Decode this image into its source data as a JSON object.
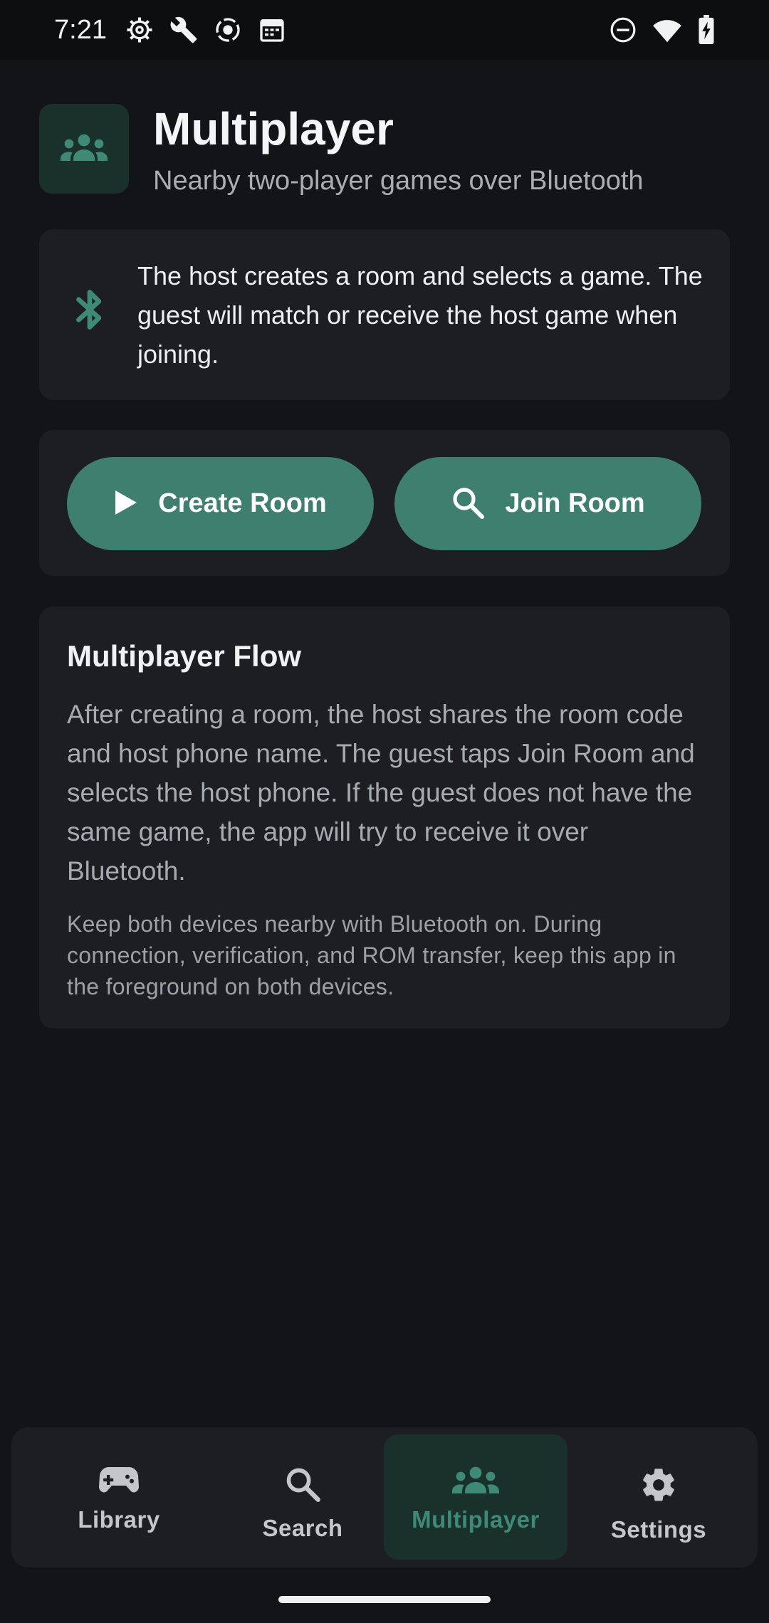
{
  "status_bar": {
    "time": "7:21",
    "left_icons": [
      "settings-gear-status-icon",
      "wrench-icon",
      "screen-record-icon",
      "calendar-icon"
    ],
    "right_icons": [
      "do-not-disturb-icon",
      "wifi-icon",
      "battery-charging-icon"
    ]
  },
  "header": {
    "icon": "group-icon",
    "title": "Multiplayer",
    "subtitle": "Nearby two-player games over Bluetooth"
  },
  "info_card": {
    "icon": "bluetooth-icon",
    "text": "The host creates a room and selects a game. The guest will match or receive the host game when joining."
  },
  "actions": {
    "create_room": {
      "icon": "play-icon",
      "label": "Create Room"
    },
    "join_room": {
      "icon": "search-icon",
      "label": "Join Room"
    }
  },
  "flow_card": {
    "title": "Multiplayer Flow",
    "body": "After creating a room, the host shares the room code and host phone name. The guest taps Join Room and selects the host phone. If the guest does not have the same game, the app will try to receive it over Bluetooth.",
    "note": "Keep both devices nearby with Bluetooth on. During connection, verification, and ROM transfer, keep this app in the foreground on both devices."
  },
  "bottom_nav": {
    "items": [
      {
        "label": "Library",
        "icon": "gamepad-icon",
        "active": false
      },
      {
        "label": "Search",
        "icon": "search-icon",
        "active": false
      },
      {
        "label": "Multiplayer",
        "icon": "group-icon",
        "active": true
      },
      {
        "label": "Settings",
        "icon": "gear-icon",
        "active": false
      }
    ]
  },
  "colors": {
    "background": "#121418",
    "card": "#1c1e22",
    "accent": "#3e7f70",
    "accent_text": "#3e8a77",
    "active_tint": "#19302b"
  }
}
